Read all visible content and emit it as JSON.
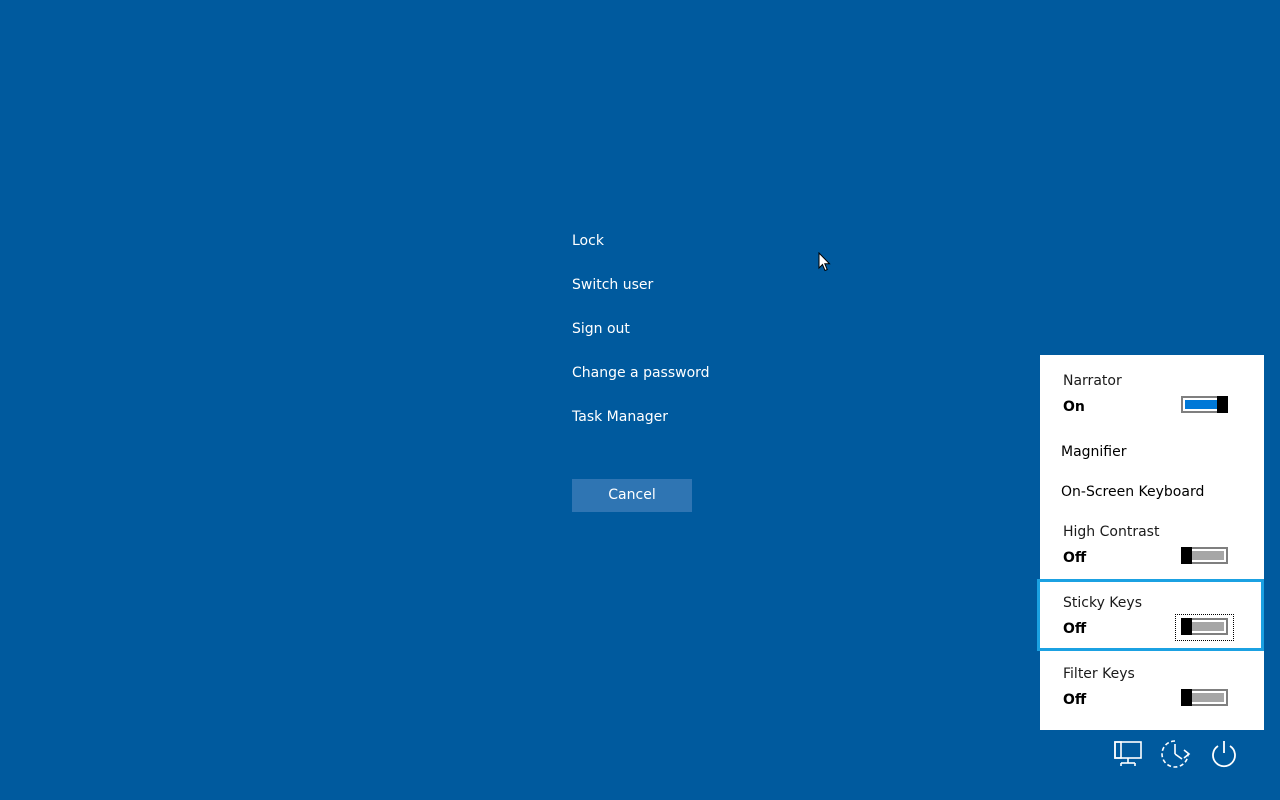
{
  "menu": {
    "items": [
      "Lock",
      "Switch user",
      "Sign out",
      "Change a password",
      "Task Manager"
    ],
    "cancel_label": "Cancel"
  },
  "accessibility_panel": {
    "narrator": {
      "title": "Narrator",
      "state": "On"
    },
    "magnifier": {
      "title": "Magnifier"
    },
    "on_screen_keyboard": {
      "title": "On-Screen Keyboard"
    },
    "high_contrast": {
      "title": "High Contrast",
      "state": "Off"
    },
    "sticky_keys": {
      "title": "Sticky Keys",
      "state": "Off"
    },
    "filter_keys": {
      "title": "Filter Keys",
      "state": "Off"
    }
  },
  "tray_icons": [
    "network-icon",
    "ease-of-access-icon",
    "power-icon"
  ],
  "colors": {
    "background": "#005a9e",
    "button": "#2f75b3",
    "toggle_on": "#0078d7",
    "focus": "#1ba1e2"
  }
}
